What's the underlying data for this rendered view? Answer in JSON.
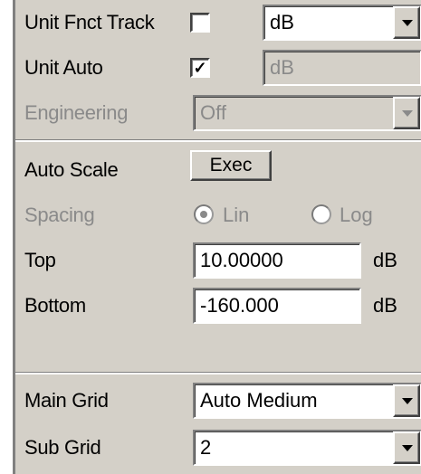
{
  "unit_fnct_track": {
    "label": "Unit Fnct Track",
    "checked": false,
    "unit_value": "dB"
  },
  "unit_auto": {
    "label": "Unit Auto",
    "checked": true,
    "check_mark": "✓",
    "unit_value": "dB"
  },
  "engineering": {
    "label": "Engineering",
    "value": "Off"
  },
  "auto_scale": {
    "label": "Auto Scale",
    "button_label": "Exec"
  },
  "spacing": {
    "label": "Spacing",
    "options": [
      "Lin",
      "Log"
    ],
    "selected": "Lin"
  },
  "top": {
    "label": "Top",
    "value": "10.00000",
    "unit": "dB"
  },
  "bottom": {
    "label": "Bottom",
    "value": "-160.000",
    "unit": "dB"
  },
  "main_grid": {
    "label": "Main Grid",
    "value": "Auto Medium"
  },
  "sub_grid": {
    "label": "Sub Grid",
    "value": "2"
  },
  "colors": {
    "panel_bg": "#d4d0c8",
    "disabled_text": "#8a8a8a"
  }
}
